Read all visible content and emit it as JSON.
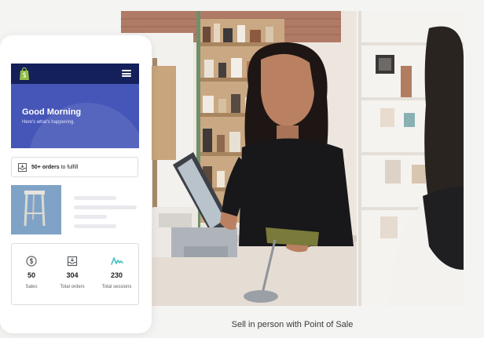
{
  "app": {
    "greeting": "Good Morning",
    "greeting_sub": "Here's what's happening.",
    "orders_count": "50+ orders",
    "orders_suffix": " to fulfill"
  },
  "stats": [
    {
      "value": "50",
      "label": "Sales",
      "icon": "dollar-icon"
    },
    {
      "value": "304",
      "label": "Total orders",
      "icon": "orders-tray-icon"
    },
    {
      "value": "230",
      "label": "Total sessions",
      "icon": "activity-wave-icon"
    }
  ],
  "caption": "Sell in person with Point of Sale",
  "colors": {
    "header_blue": "#4656b8",
    "header_top": "#13205a",
    "brand_green": "#95bf47",
    "teal_accent": "#47c1bf"
  }
}
